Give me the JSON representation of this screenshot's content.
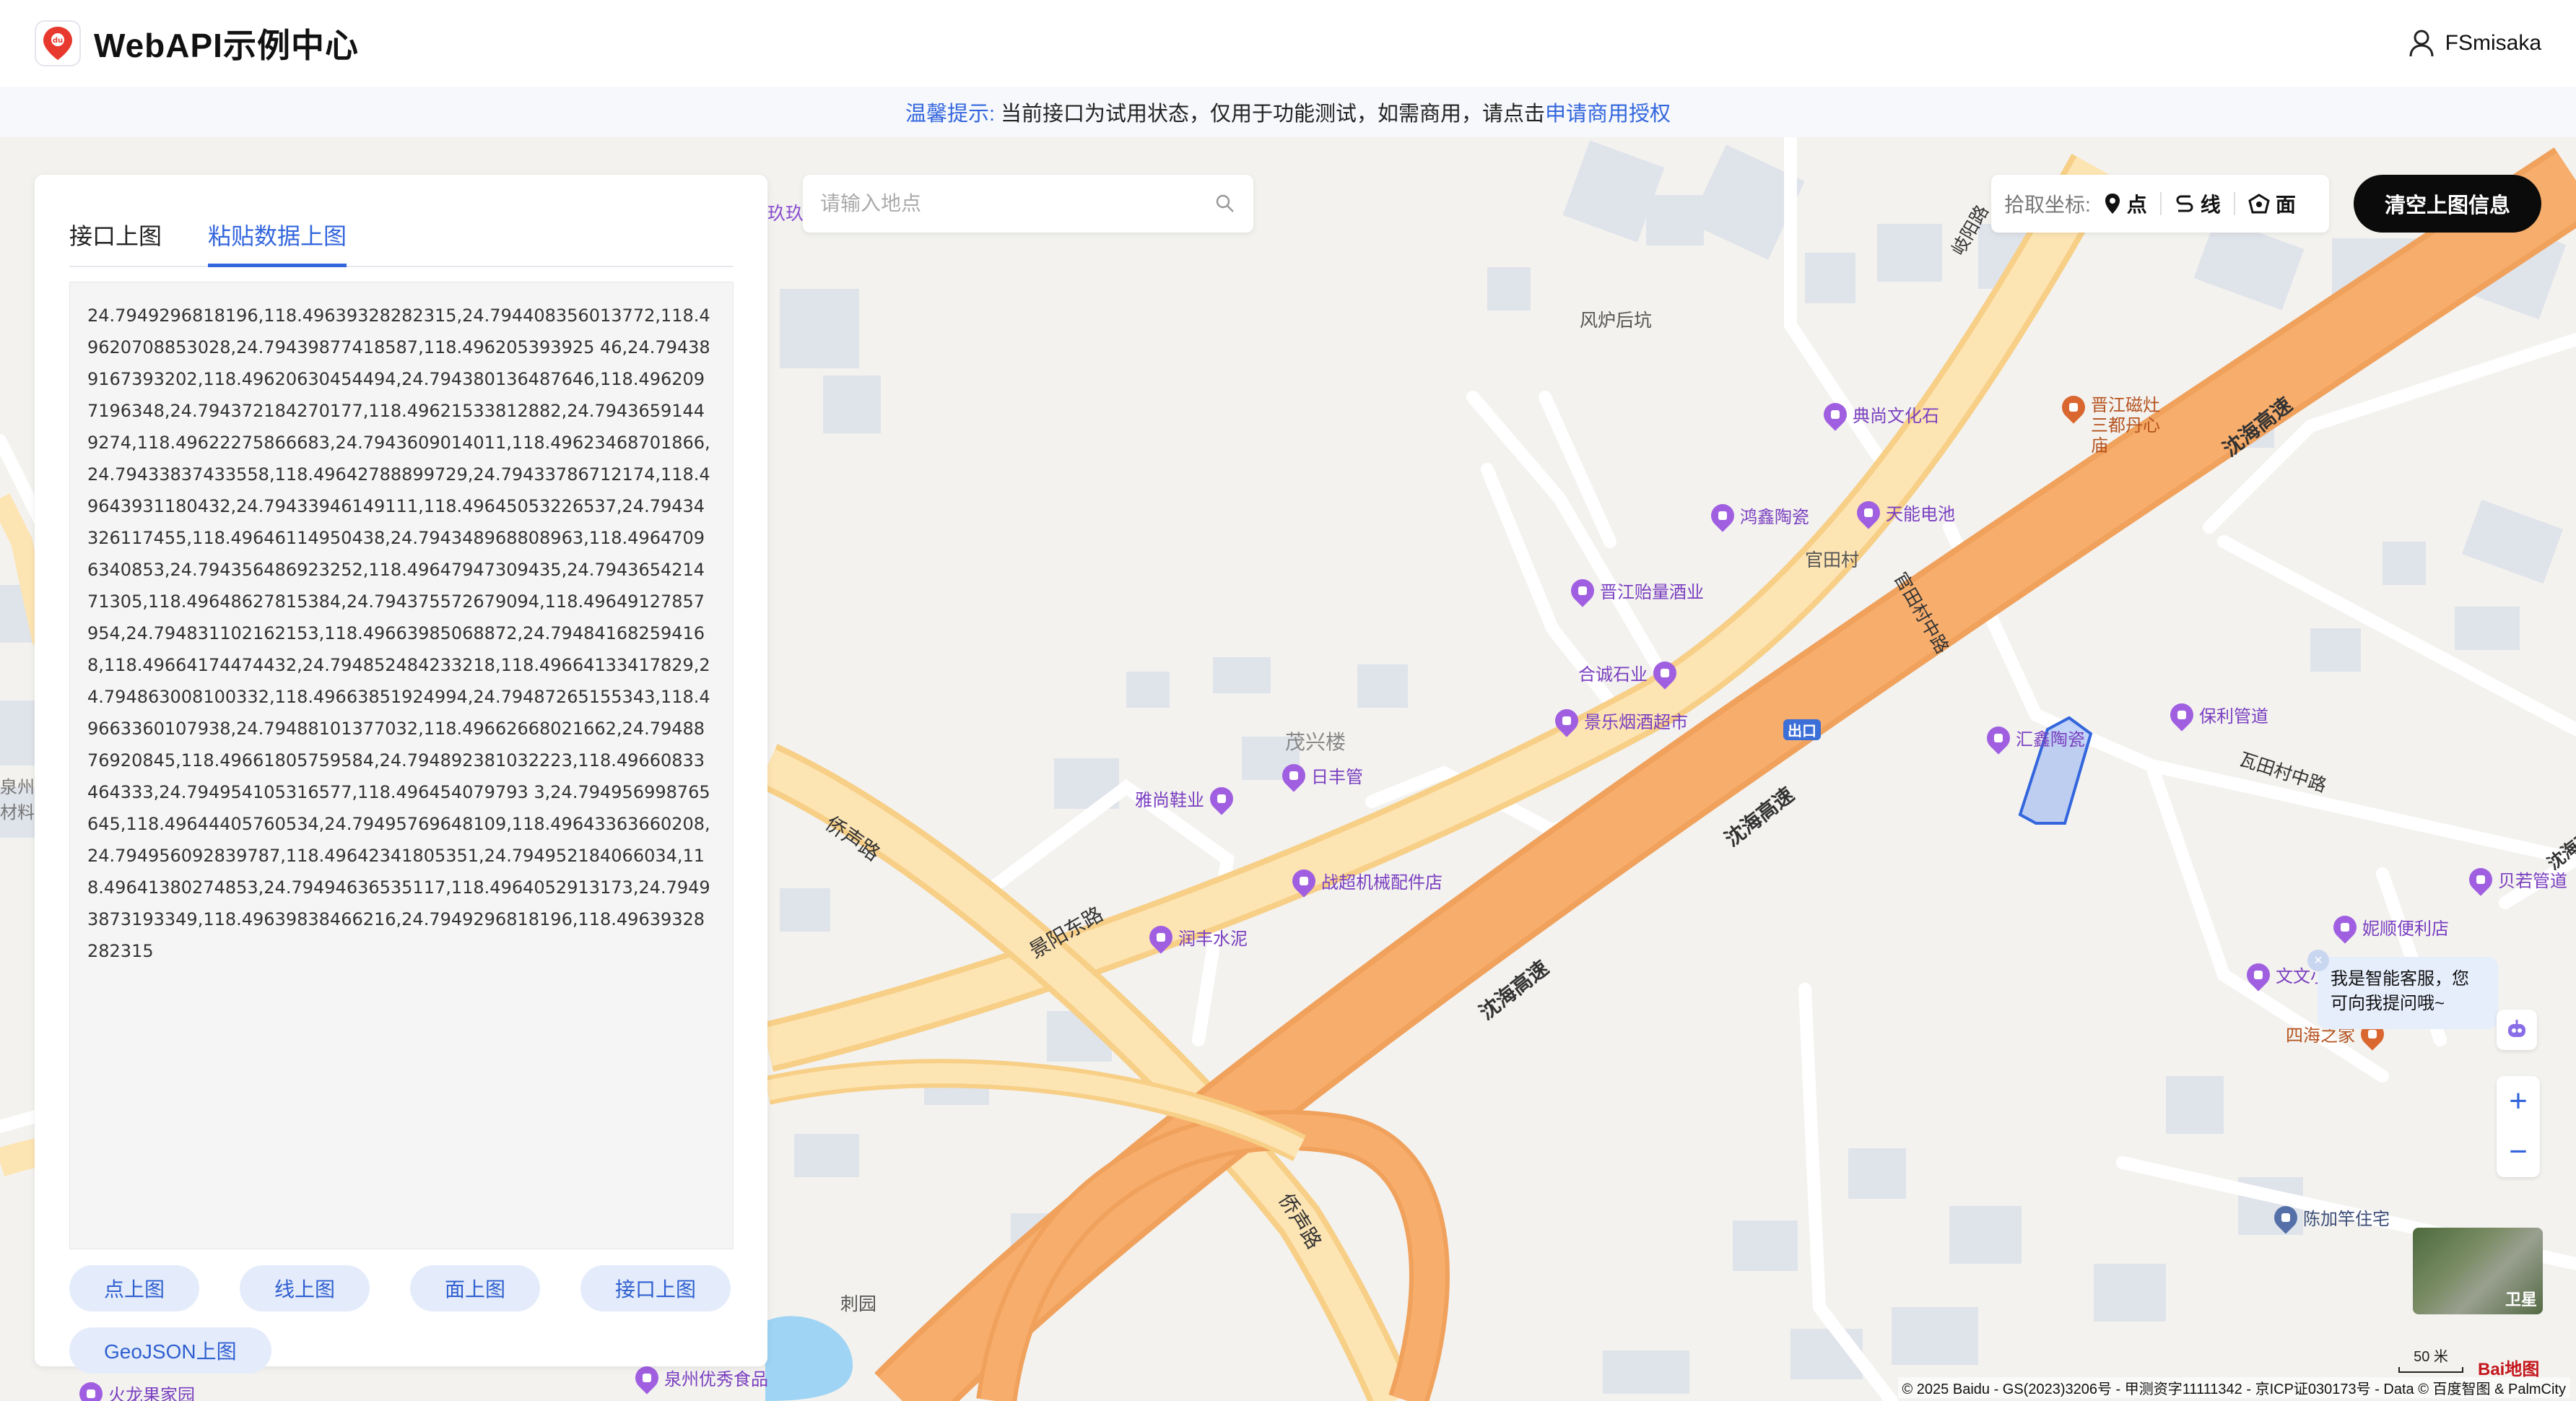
{
  "header": {
    "title": "WebAPI示例中心",
    "user_name": "FSmisaka"
  },
  "notice": {
    "tip_label": "温馨提示:",
    "text": "当前接口为试用状态，仅用于功能测试，如需商用，请点击",
    "link_label": "申请商用授权"
  },
  "panel": {
    "tabs": [
      {
        "label": "接口上图",
        "active": false
      },
      {
        "label": "粘贴数据上图",
        "active": true
      }
    ],
    "textarea_value": "24.7949296818196,118.49639328282315,24.794408356013772,118.49620708853028,24.79439877418587,118.496205393925 46,24.794389167393202,118.49620630454494,24.794380136487646,118.4962097196348,24.794372184270177,118.49621533812882,24.79436591449274,118.49622275866683,24.7943609014011,118.49623468701866,24.79433837433558,118.49642788899729,24.79433786712174,118.49643931180432,24.79433946149111,118.49645053226537,24.79434326117455,118.49646114950438,24.794348968808963,118.49647096340853,24.794356486923252,118.49647947309435,24.794365421471305,118.49648627815384,24.794375572679094,118.49649127857954,24.794831102162153,118.49663985068872,24.794841682594168,118.49664174474432,24.794852484233218,118.49664133417829,24.794863008100332,118.49663851924994,24.79487265155343,118.49663360107938,24.79488101377032,118.49662668021662,24.7948876920845,118.49661805759584,24.794892381032223,118.49660833464333,24.794954105316577,118.496454079793 3,24.794956998765645,118.49644405760534,24.79495769648109,118.49643363660208,24.794956092839787,118.49642341805351,24.794952184066034,118.49641380274853,24.79494636535117,118.4964052913173,24.79493873193349,118.49639838466216,24.7949296818196,118.49639328282315",
    "buttons": [
      "点上图",
      "线上图",
      "面上图",
      "接口上图",
      "GeoJSON上图"
    ]
  },
  "search": {
    "placeholder": "请输入地点"
  },
  "coord_tool": {
    "label": "拾取坐标:",
    "items": [
      {
        "label": "点",
        "icon": "location-pin-icon"
      },
      {
        "label": "线",
        "icon": "line-route-icon"
      },
      {
        "label": "面",
        "icon": "polygon-icon"
      }
    ]
  },
  "clear_button": "清空上图信息",
  "assistant": {
    "line1": "我是智能客服，您",
    "line2": "可向我提问哦~"
  },
  "satellite_label": "卫星",
  "scale_label": "50 米",
  "baidu_logo": "Bai地图",
  "copyright": "© 2025 Baidu - GS(2023)3206号 - 甲测资字11111342 - 京ICP证030173号 - Data © 百度智图 & PalmCity",
  "map": {
    "pois": [
      {
        "name": "典尚文化石",
        "color": "purple"
      },
      {
        "name": "晋江磁灶三都丹心庙",
        "color": "orange"
      },
      {
        "name": "鸿鑫陶瓷",
        "color": "purple"
      },
      {
        "name": "天能电池",
        "color": "purple"
      },
      {
        "name": "晋江贻量酒业",
        "color": "purple"
      },
      {
        "name": "合诚石业",
        "color": "purple"
      },
      {
        "name": "景乐烟酒超市",
        "color": "purple"
      },
      {
        "name": "日丰管",
        "color": "purple"
      },
      {
        "name": "雅尚鞋业",
        "color": "purple"
      },
      {
        "name": "战超机械配件店",
        "color": "purple"
      },
      {
        "name": "润丰水泥",
        "color": "purple"
      },
      {
        "name": "汇鑫陶瓷",
        "color": "purple"
      },
      {
        "name": "保利管道",
        "color": "purple"
      },
      {
        "name": "贝若管道",
        "color": "purple"
      },
      {
        "name": "妮顺便利店",
        "color": "purple"
      },
      {
        "name": "文文小",
        "color": "purple"
      },
      {
        "name": "四海之家",
        "color": "orange"
      },
      {
        "name": "陈加竿住宅",
        "color": "blue"
      },
      {
        "name": "火龙果家园",
        "color": "purple"
      },
      {
        "name": "泉州优秀食品",
        "color": "purple"
      }
    ],
    "places": [
      "风炉后坑",
      "官田村",
      "茂兴楼",
      "刺园",
      "玖玖",
      "泉州材料"
    ],
    "roads": [
      "沈海高速",
      "沈海高速",
      "沈海高速",
      "沈海高速",
      "侨声路",
      "侨声路",
      "景阳东路",
      "瓦田村中路",
      "官田村中路",
      "出口",
      "岐阳路"
    ]
  }
}
